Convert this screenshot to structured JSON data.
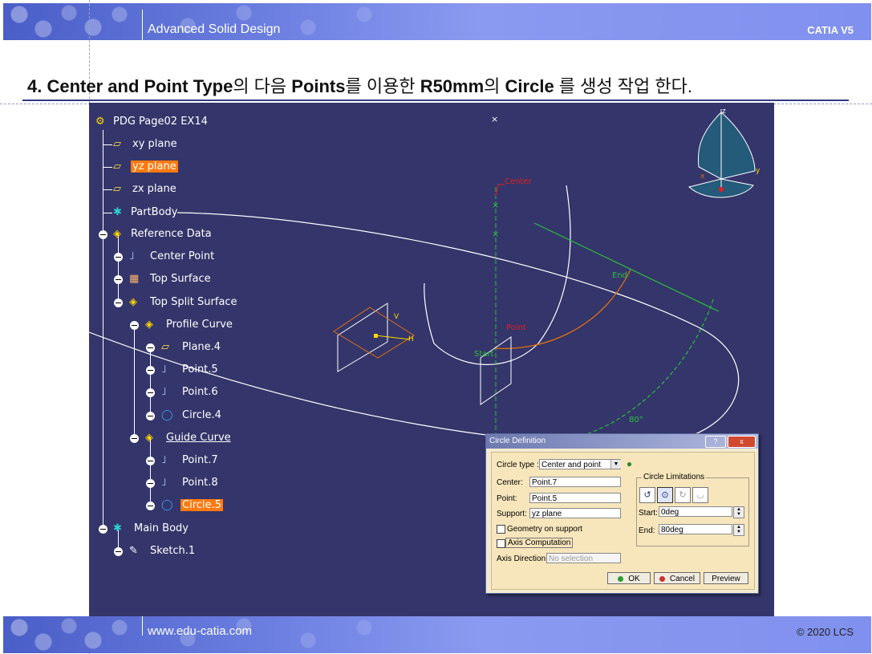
{
  "header": {
    "title": "Advanced Solid Design",
    "brand": "CATIA V5"
  },
  "footer": {
    "url": "www.edu-catia.com",
    "copyright": "© 2020 LCS"
  },
  "heading": {
    "p1": "4. ",
    "p2": "Center and Point Type",
    "p3": "의 다음 ",
    "p4": "Points",
    "p5": "를 이용한 ",
    "p6": "R50mm",
    "p7": "의 ",
    "p8": "Circle",
    "p9": " 를 생성 작업 한다."
  },
  "tree": {
    "root": "PDG Page02 EX14",
    "xy": "xy plane",
    "yz": "yz plane",
    "zx": "zx plane",
    "partbody": "PartBody",
    "refdata": "Reference Data",
    "center_point": "Center Point",
    "top_surface": "Top Surface",
    "top_split": "Top Split Surface",
    "profile_curve": "Profile Curve",
    "plane4": "Plane.4",
    "point5": "Point.5",
    "point6": "Point.6",
    "circle4": "Circle.4",
    "guide_curve": "Guide Curve",
    "point7": "Point.7",
    "point8": "Point.8",
    "circle5": "Circle.5",
    "main_body": "Main Body",
    "sketch1": "Sketch.1"
  },
  "viewport": {
    "labels": {
      "center": "Center",
      "end": "End",
      "point": "Point",
      "start": "Start",
      "angle": "80°",
      "h": "H",
      "v": "V",
      "axis_x": "x",
      "axis_y": "y",
      "axis_z": "z"
    },
    "colors": {
      "background": "#34356a",
      "selection": "#ff7a10",
      "preview": "#2bbf3c",
      "point_label": "#e02020",
      "profile": "#e07010"
    }
  },
  "dialog": {
    "title": "Circle Definition",
    "help": "?",
    "close": "x",
    "circle_type_label": "Circle type :",
    "circle_type_value": "Center and point",
    "center_label": "Center:",
    "center_value": "Point.7",
    "point_label": "Point:",
    "point_value": "Point.5",
    "support_label": "Support:",
    "support_value": "yz plane",
    "geom_support": "Geometry on support",
    "axis_comp": "Axis Computation",
    "axis_dir_label": "Axis Direction:",
    "axis_dir_value": "No selection",
    "limits_title": "Circle Limitations",
    "start_label": "Start:",
    "start_value": "0deg",
    "end_label": "End:",
    "end_value": "80deg",
    "ok": "OK",
    "cancel": "Cancel",
    "preview": "Preview"
  }
}
